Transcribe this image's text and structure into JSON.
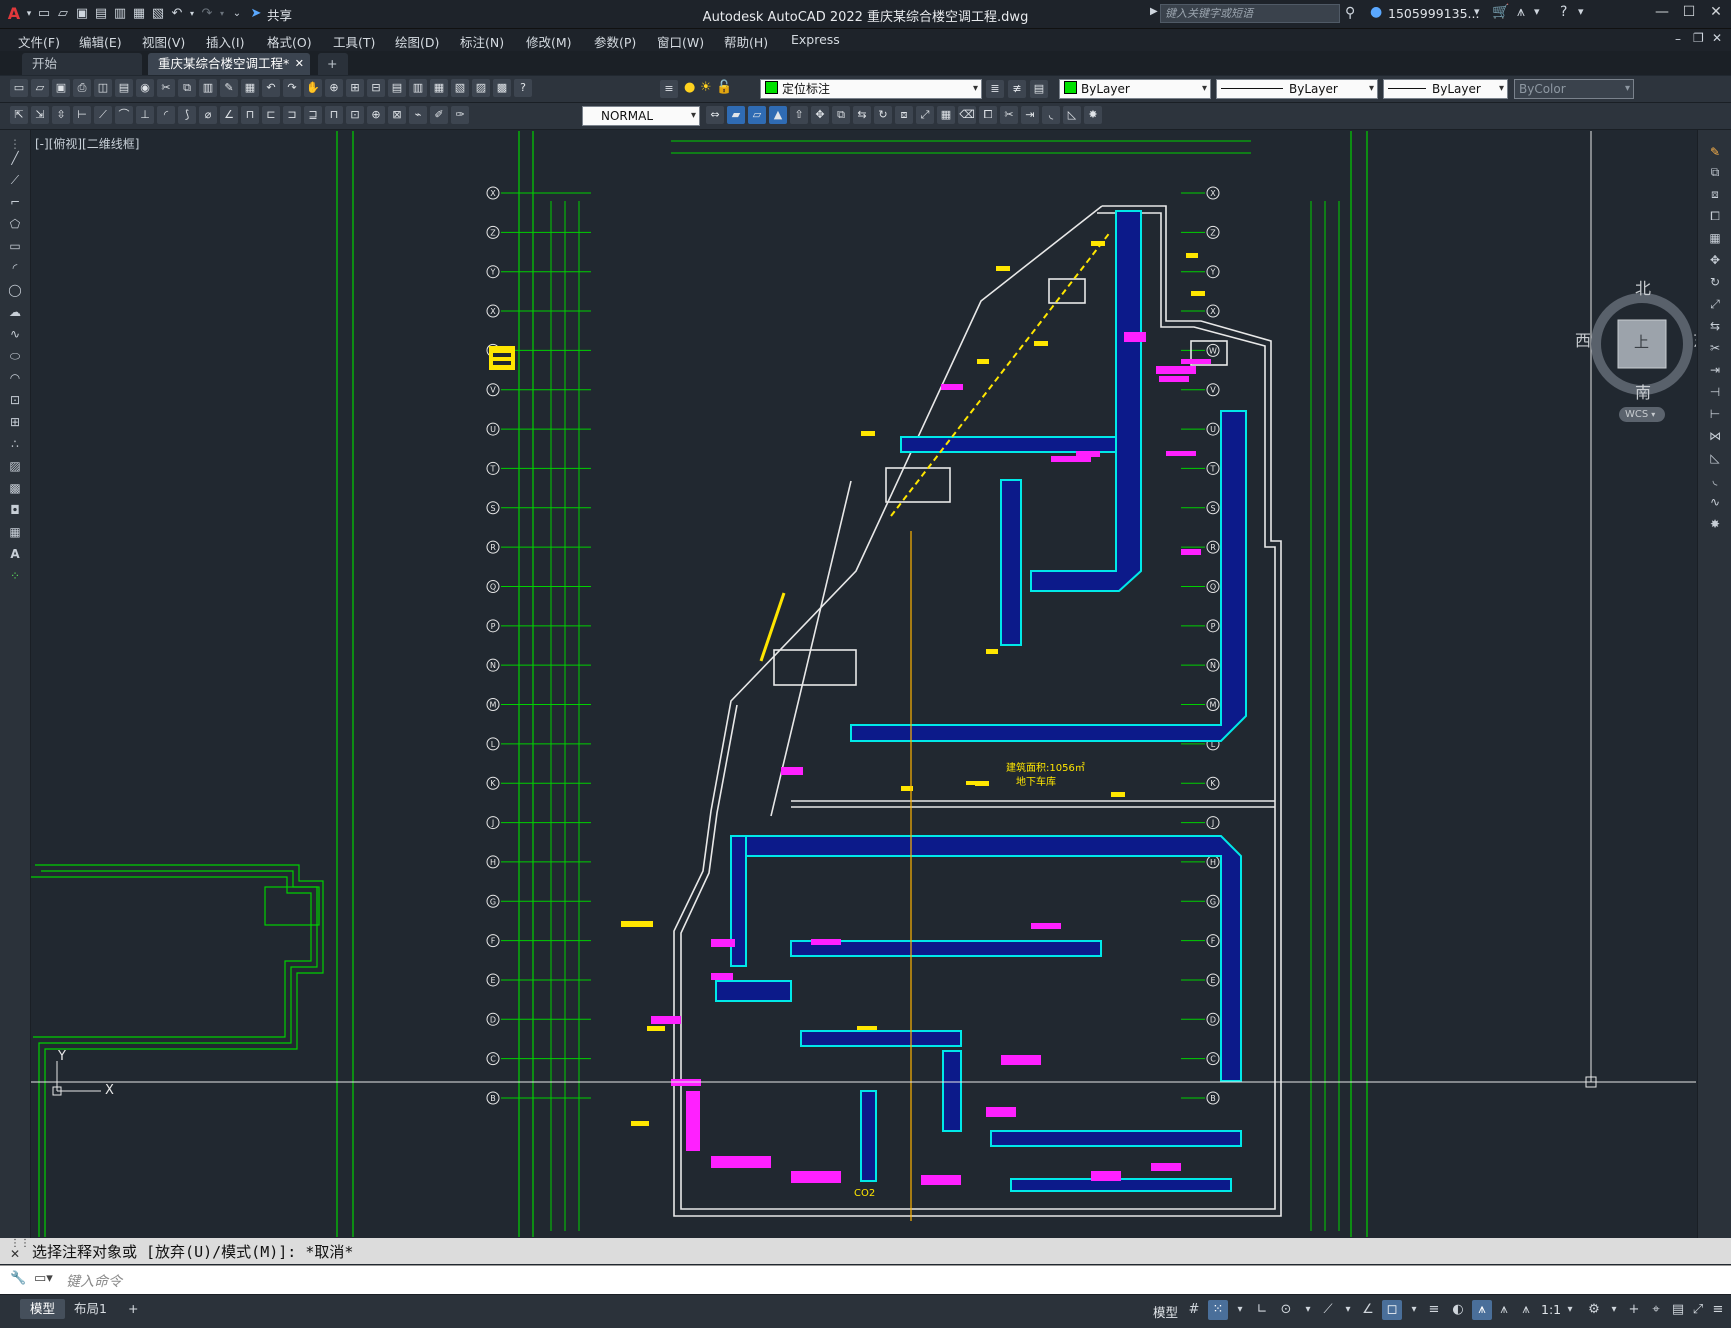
{
  "app": {
    "title": "Autodesk AutoCAD 2022    重庆某综合楼空调工程.dwg",
    "share_label": "共享",
    "search_placeholder": "键入关键字或短语",
    "user": "1505999135...",
    "colors": {
      "titlebar": "#1e232a",
      "canvas": "#212830",
      "accent_green": "#00e000",
      "duct_cyan": "#00e0e0",
      "duct_blue": "#1a3cff",
      "annot_magenta": "#ff20ff"
    }
  },
  "menu": {
    "items": [
      "文件(F)",
      "编辑(E)",
      "视图(V)",
      "插入(I)",
      "格式(O)",
      "工具(T)",
      "绘图(D)",
      "标注(N)",
      "修改(M)",
      "参数(P)",
      "窗口(W)",
      "帮助(H)",
      "Express"
    ]
  },
  "tabs": {
    "start": "开始",
    "active": "重庆某综合楼空调工程*",
    "add": "+"
  },
  "toolbar": {
    "layer_combo": "定位标注",
    "color_combo": "ByLayer",
    "linetype_combo": "ByLayer",
    "lineweight_combo": "ByLayer",
    "plotstyle_combo": "ByColor",
    "dimstyle_combo": "NORMAL"
  },
  "viewport": {
    "label": "[-][俯视][二维线框]"
  },
  "viewcube": {
    "north": "北",
    "south": "南",
    "east": "东",
    "west": "西",
    "top": "上",
    "wcs": "WCS"
  },
  "ucs": {
    "x": "X",
    "y": "Y"
  },
  "command": {
    "history": "选择注释对象或 [放弃(U)/模式(M)]: *取消*",
    "placeholder": "键入命令"
  },
  "status": {
    "tab_model": "模型",
    "tab_layout1": "布局1",
    "add": "+",
    "mode": "模型",
    "scale": "1:1"
  },
  "drawing": {
    "grid_row_labels": [
      "X",
      "Z",
      "Y",
      "X",
      "W",
      "V",
      "U",
      "T",
      "S",
      "R",
      "Q",
      "P",
      "N",
      "M",
      "L",
      "K",
      "J",
      "H",
      "G",
      "F",
      "E",
      "D",
      "C",
      "B"
    ],
    "annot_1": "建筑面积:1056㎡",
    "annot_2": "地下车库",
    "annot_3": "CO2"
  }
}
